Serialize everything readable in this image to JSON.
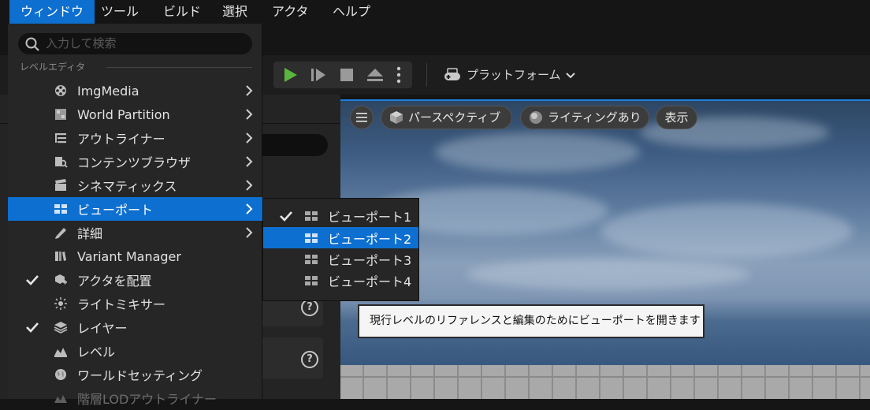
{
  "menubar": {
    "items": [
      "ウィンドウ",
      "ツール",
      "ビルド",
      "選択",
      "アクタ",
      "ヘルプ"
    ],
    "active_index": 0
  },
  "window_menu": {
    "search_placeholder": "入力して検索",
    "section_label": "レベルエディタ",
    "items": [
      {
        "label": "ImgMedia",
        "icon": "film-reel-icon",
        "checked": false,
        "submenu": true
      },
      {
        "label": "World Partition",
        "icon": "grid-map-icon",
        "checked": false,
        "submenu": true
      },
      {
        "label": "アウトライナー",
        "icon": "outliner-icon",
        "checked": false,
        "submenu": true
      },
      {
        "label": "コンテンツブラウザ",
        "icon": "folder-search-icon",
        "checked": false,
        "submenu": true
      },
      {
        "label": "シネマティックス",
        "icon": "clapperboard-icon",
        "checked": false,
        "submenu": true
      },
      {
        "label": "ビューポート",
        "icon": "viewport-icon",
        "checked": false,
        "submenu": true,
        "highlighted": true
      },
      {
        "label": "詳細",
        "icon": "pencil-icon",
        "checked": false,
        "submenu": true
      },
      {
        "label": "Variant Manager",
        "icon": "book-icon",
        "checked": false,
        "submenu": false
      },
      {
        "label": "アクタを配置",
        "icon": "place-actor-icon",
        "checked": true,
        "submenu": false
      },
      {
        "label": "ライトミキサー",
        "icon": "light-icon",
        "checked": false,
        "submenu": false
      },
      {
        "label": "レイヤー",
        "icon": "layers-icon",
        "checked": true,
        "submenu": false
      },
      {
        "label": "レベル",
        "icon": "level-icon",
        "checked": false,
        "submenu": false
      },
      {
        "label": "ワールドセッティング",
        "icon": "globe-icon",
        "checked": false,
        "submenu": false
      },
      {
        "label": "階層LODアウトライナー",
        "icon": "hlod-icon",
        "checked": false,
        "submenu": false,
        "disabled": true
      }
    ]
  },
  "viewport_submenu": {
    "items": [
      {
        "label": "ビューポート1",
        "checked": true
      },
      {
        "label": "ビューポート2",
        "checked": false,
        "highlighted": true
      },
      {
        "label": "ビューポート3",
        "checked": false
      },
      {
        "label": "ビューポート4",
        "checked": false
      }
    ]
  },
  "tooltip": "現行レベルのリファレンスと編集のためにビューポートを開きます",
  "toolbar": {
    "platforms_label": "プラットフォーム"
  },
  "viewport_toolbar": {
    "perspective_label": "パースペクティブ",
    "lighting_label": "ライティングあり",
    "show_label": "表示"
  },
  "colors": {
    "highlight": "#0d6fcf",
    "play_green": "#5ab53f"
  }
}
